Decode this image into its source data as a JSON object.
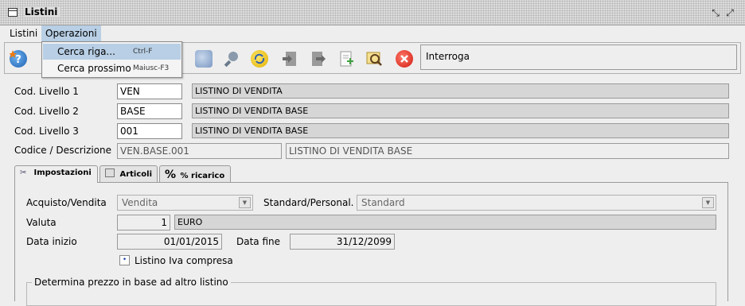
{
  "window": {
    "title": "Listini"
  },
  "menubar": {
    "items": [
      "Listini",
      "Operazioni"
    ]
  },
  "dropdown": {
    "items": [
      {
        "label": "Cerca riga...",
        "shortcut": "Ctrl-F"
      },
      {
        "label": "Cerca prossimo",
        "shortcut": "Maiusc-F3"
      }
    ]
  },
  "toolbar": {
    "icons": [
      "star-help-icon",
      "scanner-icon",
      "search-icon",
      "refresh-icon",
      "document-in-icon",
      "document-out-icon",
      "new-document-icon",
      "magnify-document-icon",
      "close-icon"
    ],
    "status": "Interroga"
  },
  "form": {
    "cod_livello_1": {
      "label": "Cod. Livello 1",
      "value": "VEN",
      "description": "LISTINO DI VENDITA"
    },
    "cod_livello_2": {
      "label": "Cod. Livello 2",
      "value": "BASE",
      "description": "LISTINO DI VENDITA BASE"
    },
    "cod_livello_3": {
      "label": "Cod. Livello 3",
      "value": "001",
      "description": "LISTINO DI VENDITA BASE"
    },
    "codice_descrizione": {
      "label": "Codice / Descrizione",
      "code": "VEN.BASE.001",
      "description": "LISTINO DI VENDITA BASE"
    }
  },
  "tabs": [
    {
      "label": "Impostazioni",
      "icon": "tools-icon"
    },
    {
      "label": "Articoli",
      "icon": "box-icon"
    },
    {
      "label": "% ricarico",
      "icon": "percent-icon",
      "icon_text": "%"
    }
  ],
  "impostazioni": {
    "acquisto_vendita": {
      "label": "Acquisto/Vendita",
      "value": "Vendita"
    },
    "standard_personal": {
      "label": "Standard/Personal.",
      "value": "Standard"
    },
    "valuta": {
      "label": "Valuta",
      "code": "1",
      "description": "EURO"
    },
    "data_inizio": {
      "label": "Data inizio",
      "value": "01/01/2015"
    },
    "data_fine": {
      "label": "Data fine",
      "value": "31/12/2099"
    },
    "listino_iva": {
      "label": "Listino Iva compresa",
      "checked": true
    },
    "group_title": "Determina prezzo in base ad altro listino"
  },
  "colors": {
    "selection": "#b8cfe5",
    "panel": "#eeeeee"
  }
}
